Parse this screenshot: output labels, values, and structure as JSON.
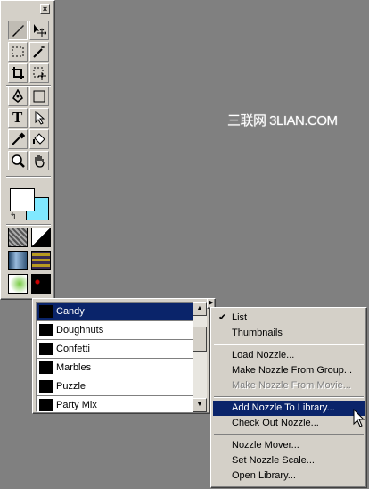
{
  "watermark": "三联网 3LIAN.COM",
  "toolbox": {
    "close_glyph": "×",
    "tools": [
      {
        "name": "paint-brush-tool",
        "icon": "brush-icon",
        "pressed": true
      },
      {
        "name": "move-tool",
        "icon": "move-icon",
        "pressed": false
      },
      {
        "name": "marquee-tool",
        "icon": "marquee-icon",
        "pressed": false
      },
      {
        "name": "magic-wand-tool",
        "icon": "magic-wand-icon",
        "pressed": false
      },
      {
        "name": "crop-tool",
        "icon": "crop-icon",
        "pressed": false
      },
      {
        "name": "transform-tool",
        "icon": "transform-icon",
        "pressed": false
      },
      {
        "name": "pen-tool",
        "icon": "pen-icon",
        "pressed": false
      },
      {
        "name": "rectangle-tool",
        "icon": "rectangle-icon",
        "pressed": false
      },
      {
        "name": "text-tool",
        "icon": "text-icon",
        "pressed": false
      },
      {
        "name": "arrow-tool",
        "icon": "arrow-icon",
        "pressed": false
      },
      {
        "name": "eyedropper-tool",
        "icon": "eyedropper-icon",
        "pressed": false
      },
      {
        "name": "paint-bucket-tool",
        "icon": "paint-bucket-icon",
        "pressed": false
      },
      {
        "name": "zoom-tool",
        "icon": "magnifier-icon",
        "pressed": false
      },
      {
        "name": "hand-tool",
        "icon": "hand-icon",
        "pressed": false
      }
    ],
    "fg_color": "#ffffff",
    "bg_color": "#80e8ff",
    "text_tool_glyph": "T"
  },
  "nozzle_list": {
    "items": [
      {
        "label": "Candy",
        "selected": true
      },
      {
        "label": "Doughnuts",
        "selected": false
      },
      {
        "label": "Confetti",
        "selected": false
      },
      {
        "label": "Marbles",
        "selected": false
      },
      {
        "label": "Puzzle",
        "selected": false
      },
      {
        "label": "Party Mix",
        "selected": false
      }
    ],
    "menu_button_glyph": "▶"
  },
  "menu": {
    "check_glyph": "✔",
    "items": [
      {
        "label": "List",
        "checked": true,
        "disabled": false,
        "highlighted": false
      },
      {
        "label": "Thumbnails",
        "checked": false,
        "disabled": false,
        "highlighted": false
      },
      {
        "label": "Load Nozzle...",
        "checked": false,
        "disabled": false,
        "highlighted": false
      },
      {
        "label": "Make Nozzle From Group...",
        "checked": false,
        "disabled": false,
        "highlighted": false
      },
      {
        "label": "Make Nozzle From Movie...",
        "checked": false,
        "disabled": true,
        "highlighted": false
      },
      {
        "label": "Add Nozzle To Library...",
        "checked": false,
        "disabled": false,
        "highlighted": true
      },
      {
        "label": "Check Out Nozzle...",
        "checked": false,
        "disabled": false,
        "highlighted": false
      },
      {
        "label": "Nozzle Mover...",
        "checked": false,
        "disabled": false,
        "highlighted": false
      },
      {
        "label": "Set Nozzle Scale...",
        "checked": false,
        "disabled": false,
        "highlighted": false
      },
      {
        "label": "Open Library...",
        "checked": false,
        "disabled": false,
        "highlighted": false
      }
    ]
  }
}
